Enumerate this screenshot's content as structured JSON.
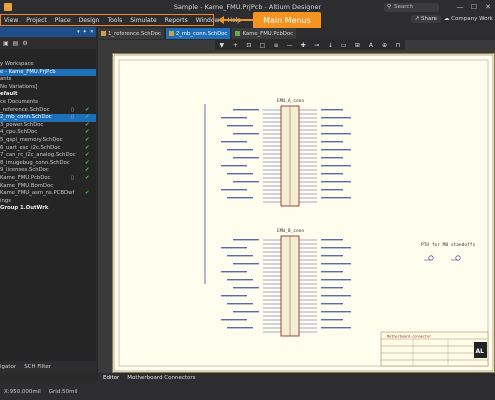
{
  "titlebar": {
    "title": "Sample - Kame_FMU.PrjPcb - Altium Designer",
    "search_placeholder": "Search",
    "minimize": "—",
    "maximize": "☐",
    "close": "✕"
  },
  "menubar": {
    "items": [
      "View",
      "Project",
      "Place",
      "Design",
      "Tools",
      "Simulate",
      "Reports",
      "Window",
      "Help"
    ],
    "share": "Share",
    "workspace": "Company Work"
  },
  "callout": {
    "label": "Main Menus",
    "color": "#f39321"
  },
  "projects_panel": {
    "items": [
      {
        "label": "y Workspace",
        "style": "normal"
      },
      {
        "label": "e - Kame_FMU.PrjPcb",
        "style": "selected"
      },
      {
        "label": "ants",
        "style": "normal"
      },
      {
        "label": "No Variations]",
        "style": "normal"
      },
      {
        "label": "efault",
        "style": "bold"
      },
      {
        "label": "ce Documents",
        "style": "normal"
      },
      {
        "label": "_reference.SchDoc",
        "style": "normal",
        "doc": true,
        "check": true
      },
      {
        "label": "2_mb_conn.SchDoc",
        "style": "selected",
        "doc": true,
        "check": true
      },
      {
        "label": "3_power.SchDoc",
        "style": "normal",
        "check": true
      },
      {
        "label": "4_cpu.SchDoc",
        "style": "normal",
        "check": true
      },
      {
        "label": "5_qspi_memory.SchDoc",
        "style": "normal",
        "check": true
      },
      {
        "label": "6_uart_esc_i2c.SchDoc",
        "style": "normal",
        "check": true
      },
      {
        "label": "7_can_rc_i2c_analog.SchDoc",
        "style": "normal",
        "check": true
      },
      {
        "label": "8_imugebug_conn.SchDoc",
        "style": "normal",
        "check": true
      },
      {
        "label": "9_licenses.SchDoc",
        "style": "normal",
        "check": true
      },
      {
        "label": "Kame_FMU.PcbDoc",
        "style": "normal",
        "doc": true,
        "check": true
      },
      {
        "label": "Kame_FMU.BomDoc",
        "style": "normal"
      },
      {
        "label": "Kame_FMU_asm_ns.PCBDwf",
        "style": "normal",
        "check": true
      },
      {
        "label": "ings",
        "style": "normal"
      },
      {
        "label": "Group 1.OutWrk",
        "style": "bold"
      }
    ],
    "bottom_tabs": [
      "igator",
      "SCH Filter"
    ]
  },
  "doc_tabs": [
    {
      "label": "1_reference.SchDoc",
      "active": false
    },
    {
      "label": "2_mb_conn.SchDoc",
      "active": true
    },
    {
      "label": "Kame_FMU.PcbDoc",
      "active": false
    }
  ],
  "active_bar": {
    "tools": [
      "▼",
      "+",
      "⊡",
      "□",
      "≡",
      "—",
      "✚",
      "⊸",
      "↓",
      "▭",
      "⊞",
      "A",
      "⊕",
      "⊓"
    ]
  },
  "schematic": {
    "block_a_title": "EMU_A_conn",
    "block_b_title": "EMU_B_conn",
    "pth_label": "PTH for MB standoffs",
    "title_block_name": "Motherboard connector",
    "logo": "AL"
  },
  "editor_tabs": [
    "Editor",
    "Motherboard Connectors"
  ],
  "statusbar": {
    "coords": "X:950.000mil",
    "grid": "Grid:50mil"
  }
}
